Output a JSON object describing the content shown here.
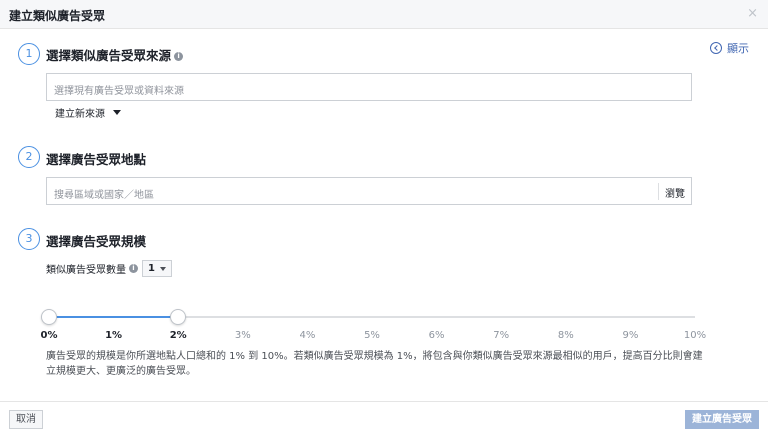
{
  "dialog": {
    "title": "建立類似廣告受眾",
    "close_glyph": "×"
  },
  "show_link": {
    "label": "顯示"
  },
  "step1": {
    "number": "1",
    "title": "選擇類似廣告受眾來源",
    "input_placeholder": "選擇現有廣告受眾或資料來源",
    "create_source_label": "建立新來源"
  },
  "step2": {
    "number": "2",
    "title": "選擇廣告受眾地點",
    "input_placeholder": "搜尋區域或國家／地區",
    "browse_label": "瀏覽"
  },
  "step3": {
    "number": "3",
    "title": "選擇廣告受眾規模",
    "count_label": "類似廣告受眾數量",
    "count_value": "1",
    "slider": {
      "min": 0,
      "max": 10,
      "range_start": 0,
      "range_end": 2,
      "ticks": [
        "0%",
        "1%",
        "2%",
        "3%",
        "4%",
        "5%",
        "6%",
        "7%",
        "8%",
        "9%",
        "10%"
      ]
    },
    "description": "廣告受眾的規模是你所選地點人口總和的 1% 到 10%。若類似廣告受眾規模為 1%，將包含與你類似廣告受眾來源最相似的用戶，提高百分比則會建立規模更大、更廣泛的廣告受眾。"
  },
  "footer": {
    "cancel_label": "取消",
    "create_label": "建立廣告受眾"
  },
  "colors": {
    "accent": "#4a90e2",
    "link": "#4267b2",
    "primary_disabled": "#9cb4d8"
  },
  "icons": {
    "info": "info-icon",
    "close": "close-icon",
    "chevron_left_circle": "chevron-left-circle-icon",
    "caret_down": "caret-down-icon"
  }
}
